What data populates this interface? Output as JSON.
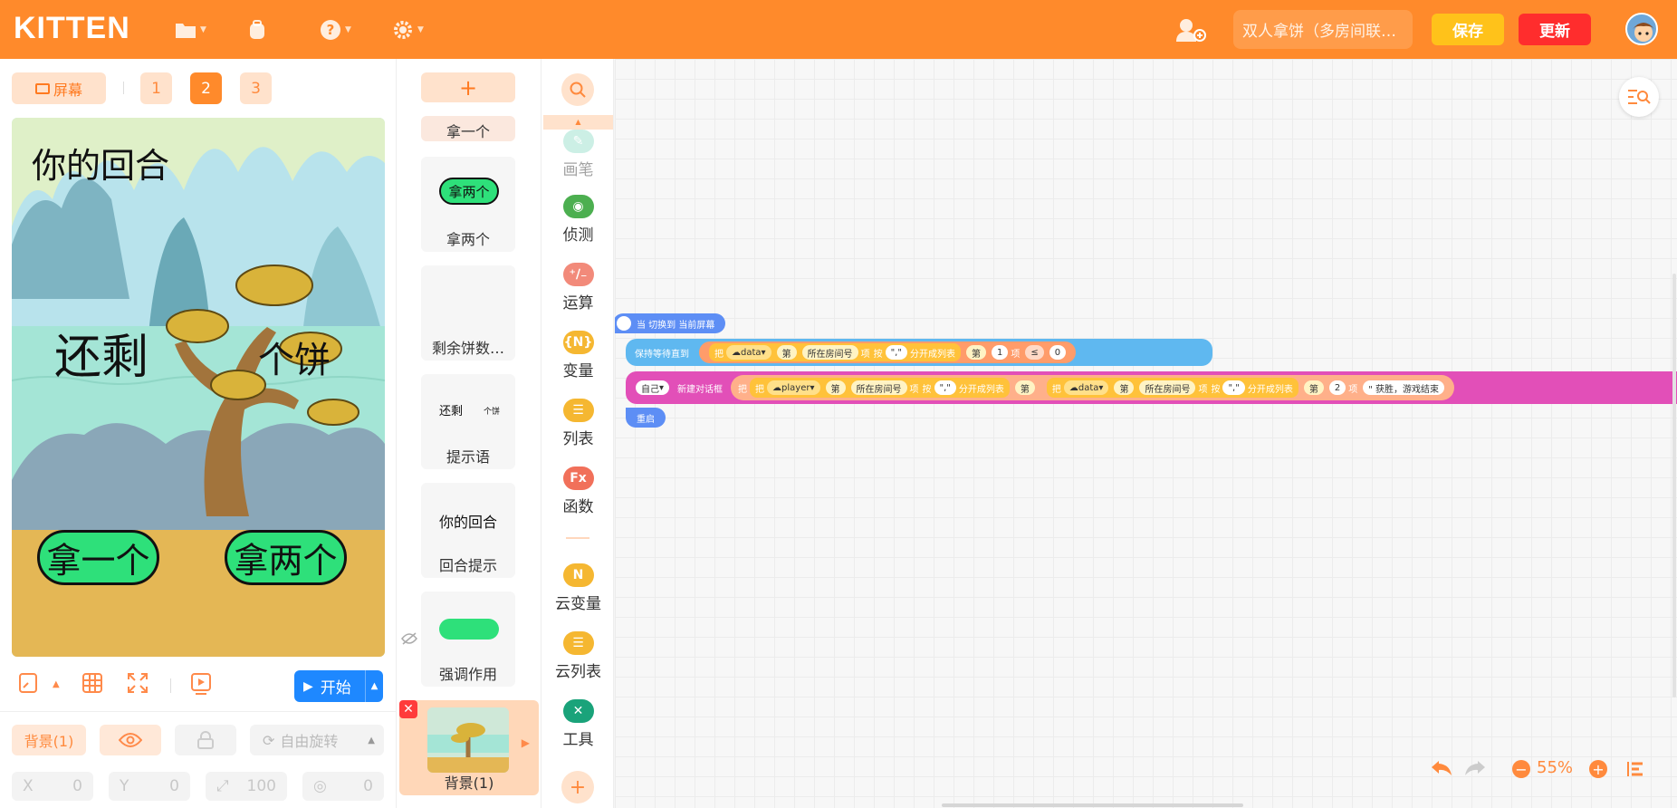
{
  "app": {
    "logo": "KITTEN",
    "project_name": "双人拿饼（多房间联…",
    "save_label": "保存",
    "update_label": "更新"
  },
  "screens": {
    "screen_label": "屏幕",
    "tabs": [
      "1",
      "2",
      "3"
    ],
    "active_tab": "2"
  },
  "stage": {
    "texts": {
      "your_turn": "你的回合",
      "remaining": "还剩",
      "cakes": "个饼"
    },
    "buttons": {
      "take_one": "拿一个",
      "take_two": "拿两个"
    },
    "start_label": "开始"
  },
  "properties": {
    "sprite_name": "背景(1)",
    "rotation_label": "自由旋转",
    "x_label": "X",
    "x_value": "0",
    "y_label": "Y",
    "y_value": "0",
    "size_value": "100",
    "direction_value": "0"
  },
  "sprites": {
    "add_label": "+",
    "items": [
      {
        "name": "拿一个"
      },
      {
        "name": "拿两个",
        "thumb_text": "拿两个"
      },
      {
        "name": "剩余饼数…"
      },
      {
        "name": "提示语",
        "thumb_text_a": "还剩",
        "thumb_text_b": "个饼"
      },
      {
        "name": "回合提示",
        "thumb_text": "你的回合"
      },
      {
        "name": "强调作用"
      },
      {
        "name": "背景(1)"
      }
    ]
  },
  "categories": {
    "items": [
      {
        "label": "画笔",
        "color": "#8fdcc7",
        "icon": "pen-icon"
      },
      {
        "label": "侦测",
        "color": "#4caf50",
        "icon": "detect-icon"
      },
      {
        "label": "运算",
        "color": "#f28a7a",
        "icon": "operator-icon"
      },
      {
        "label": "变量",
        "color": "#f5b731",
        "icon": "variable-icon",
        "icon_text": "{N}"
      },
      {
        "label": "列表",
        "color": "#f5b731",
        "icon": "list-icon"
      },
      {
        "label": "函数",
        "color": "#f1705a",
        "icon": "function-icon",
        "icon_text": "Fx"
      },
      {
        "label": "云变量",
        "color": "#f5b731",
        "icon": "cloud-variable-icon",
        "icon_text": "N"
      },
      {
        "label": "云列表",
        "color": "#f5b731",
        "icon": "cloud-list-icon"
      },
      {
        "label": "工具",
        "color": "#1aa37a",
        "icon": "tool-icon"
      }
    ]
  },
  "blocks": {
    "hat": "当 切换到 当前屏幕",
    "wait_until": "保持等待直到",
    "take": "把",
    "var_data": "data",
    "var_player": "player",
    "nth": "第",
    "room_no": "所在房间号",
    "item": "项",
    "by": "按",
    "comma": "\",\"",
    "split": "分开成列表",
    "num1": "1",
    "num2": "2",
    "lte": "≤",
    "zero": "0",
    "self": "自己",
    "new_dialog": "新建对话框",
    "win_text": "\" 获胜，游戏结束",
    "restart": "重启"
  },
  "workspace": {
    "zoom": "55%"
  },
  "colors": {
    "brand": "#ff8a2b",
    "save": "#ffc21a",
    "update": "#ff2d2d",
    "start": "#1e88ff"
  }
}
